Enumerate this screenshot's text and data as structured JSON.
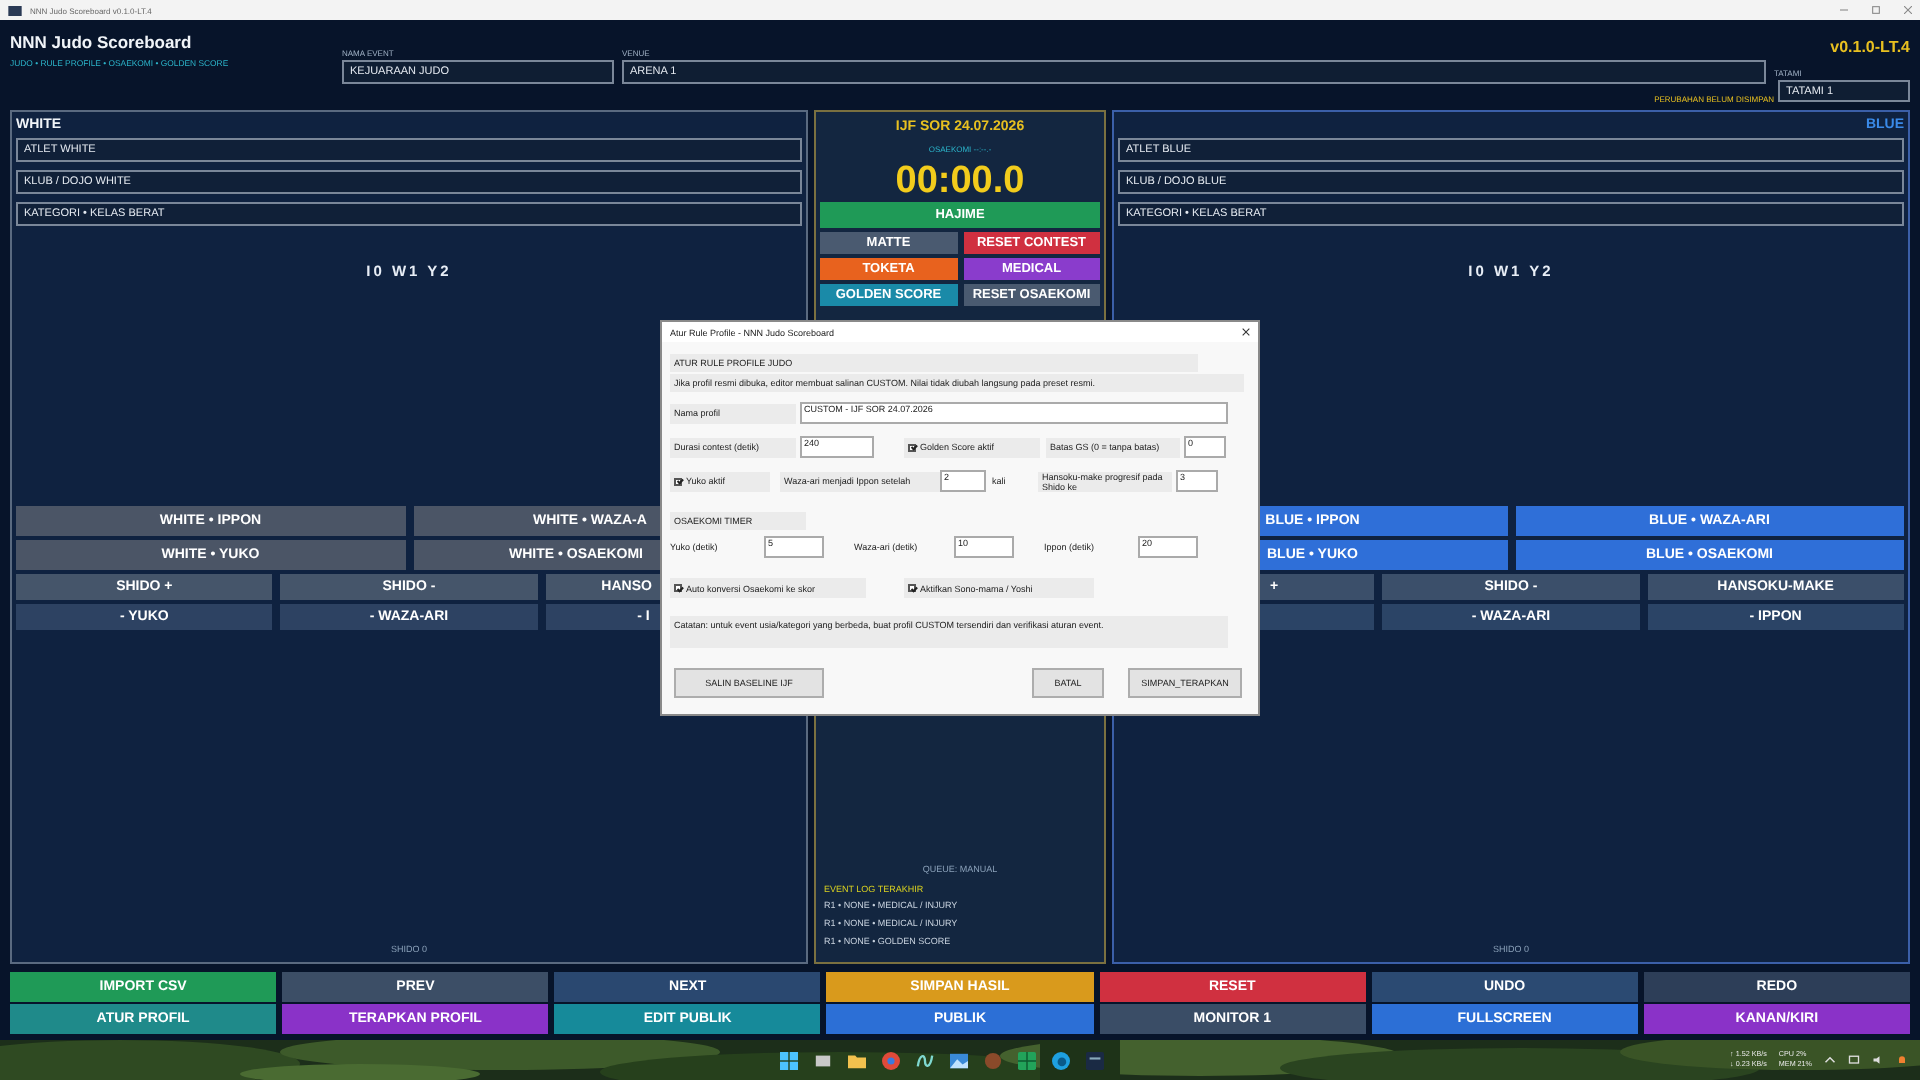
{
  "window": {
    "title": "NNN Judo Scoreboard v0.1.0-LT.4"
  },
  "header": {
    "app_title": "NNN Judo Scoreboard",
    "subtitle": "JUDO • RULE PROFILE • OSAEKOMI • GOLDEN SCORE",
    "version": "v0.1.0-LT.4",
    "unsaved_notice": "PERUBAHAN BELUM DISIMPAN",
    "event": {
      "label": "NAMA EVENT",
      "value": "KEJUARAAN JUDO"
    },
    "venue": {
      "label": "VENUE",
      "value": "ARENA 1"
    },
    "tatami": {
      "label": "TATAMI",
      "value": "TATAMI 1"
    }
  },
  "panels": [
    {
      "kind": "white",
      "title": "WHITE",
      "fields": [
        "ATLET WHITE",
        "KLUB / DOJO WHITE",
        "KATEGORI • KELAS BERAT"
      ],
      "score": "I0 W1 Y2",
      "score_buttons": [
        "WHITE • IPPON",
        "WHITE • WAZA-A",
        "WHITE • YUKO",
        "WHITE • OSAEKOMI"
      ],
      "penalty_buttons": [
        "SHIDO +",
        "SHIDO -",
        "HANSO"
      ],
      "undo_buttons": [
        "- YUKO",
        "- WAZA-ARI",
        "- I"
      ],
      "shido": "SHIDO 0"
    },
    {
      "kind": "blue",
      "title": "BLUE",
      "fields": [
        "ATLET BLUE",
        "KLUB / DOJO BLUE",
        "KATEGORI • KELAS BERAT"
      ],
      "score": "I0 W1 Y2",
      "score_buttons": [
        "BLUE • IPPON",
        "BLUE • WAZA-ARI",
        "BLUE • YUKO",
        "BLUE • OSAEKOMI"
      ],
      "penalty_buttons": [
        "+",
        "SHIDO -",
        "HANSOKU-MAKE"
      ],
      "undo_buttons": [
        "- WAZA-ARI",
        "- IPPON"
      ],
      "shido": "SHIDO 0"
    }
  ],
  "center": {
    "title": "IJF SOR 24.07.2026",
    "osaekomi": "OSAEKOMI --:--.-",
    "timer": "00:00.0",
    "buttons": [
      {
        "label": "HAJIME",
        "color": "#1f9a57"
      },
      {
        "label": "MATTE",
        "color": "#4a5a70"
      },
      {
        "label": "RESET CONTEST",
        "color": "#d03040"
      },
      {
        "label": "TOKETA",
        "color": "#e8621e"
      },
      {
        "label": "MEDICAL",
        "color": "#8a3ccc"
      },
      {
        "label": "GOLDEN SCORE",
        "color": "#1a8aa8"
      },
      {
        "label": "RESET OSAEKOMI",
        "color": "#4a5a70"
      }
    ],
    "queue": "QUEUE: MANUAL",
    "log_title": "EVENT LOG TERAKHIR",
    "log": [
      "R1 • NONE • MEDICAL / INJURY",
      "R1 • NONE • MEDICAL / INJURY",
      "R1 • NONE • GOLDEN SCORE"
    ]
  },
  "toolbar": [
    {
      "label": "IMPORT CSV",
      "color": "#1f9a57"
    },
    {
      "label": "PREV",
      "color": "#3c4e66"
    },
    {
      "label": "NEXT",
      "color": "#2a4870"
    },
    {
      "label": "SIMPAN HASIL",
      "color": "#d99a1c"
    },
    {
      "label": "RESET",
      "color": "#d03040"
    },
    {
      "label": "UNDO",
      "color": "#2b4a72"
    },
    {
      "label": "REDO",
      "color": "#2d3e58"
    },
    {
      "label": "ATUR PROFIL",
      "color": "#1f8a8a"
    },
    {
      "label": "TERAPKAN PROFIL",
      "color": "#8a32c8"
    },
    {
      "label": "EDIT PUBLIK",
      "color": "#168a9a"
    },
    {
      "label": "PUBLIK",
      "color": "#2c6fd6"
    },
    {
      "label": "MONITOR 1",
      "color": "#3a4d66"
    },
    {
      "label": "FULLSCREEN",
      "color": "#2c6fd6"
    },
    {
      "label": "KANAN/KIRI",
      "color": "#8a32c8"
    }
  ],
  "dialog": {
    "title": "Atur Rule Profile - NNN Judo Scoreboard",
    "heading": "ATUR RULE PROFILE JUDO",
    "info": "Jika profil resmi dibuka, editor membuat salinan CUSTOM. Nilai tidak diubah langsung pada preset resmi.",
    "profile_name": {
      "label": "Nama profil",
      "value": "CUSTOM - IJF SOR 24.07.2026"
    },
    "duration": {
      "label": "Durasi contest (detik)",
      "value": "240"
    },
    "golden_score": {
      "label": "Golden Score aktif",
      "checked": true
    },
    "gs_limit": {
      "label": "Batas GS (0 = tanpa batas)",
      "value": "0"
    },
    "yuko": {
      "label": "Yuko aktif",
      "checked": true
    },
    "waza_to_ippon": {
      "label": "Waza-ari menjadi Ippon setelah",
      "value": "2",
      "unit": "kali"
    },
    "hansoku": {
      "label": "Hansoku-make progresif pada Shido ke",
      "value": "3"
    },
    "osaekomi_heading": "OSAEKOMI TIMER",
    "osaekomi_times": [
      {
        "label": "Yuko (detik)",
        "value": "5"
      },
      {
        "label": "Waza-ari (detik)",
        "value": "10"
      },
      {
        "label": "Ippon (detik)",
        "value": "20"
      }
    ],
    "auto_convert": {
      "label": "Auto konversi Osaekomi ke skor",
      "checked": true
    },
    "sonomama": {
      "label": "Aktifkan Sono-mama / Yoshi",
      "checked": true
    },
    "note": "Catatan: untuk event usia/kategori yang berbeda, buat profil CUSTOM tersendiri dan verifikasi aturan event.",
    "buttons": [
      "SALIN BASELINE IJF",
      "BATAL",
      "SIMPAN_TERAPKAN"
    ]
  },
  "taskbar": {
    "net_up": "↑ 1.52 KB/s",
    "net_down": "↓ 0.23 KB/s",
    "cpu": "CPU 2%",
    "mem": "MEM 21%"
  }
}
